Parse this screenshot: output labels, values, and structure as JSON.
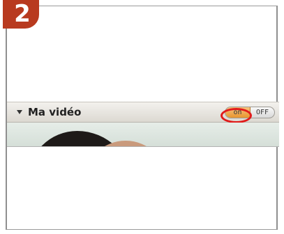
{
  "step": {
    "number": "2"
  },
  "panel": {
    "title": "Ma vidéo",
    "toggle": {
      "on_label": "on",
      "off_label": "OFF",
      "state": "on"
    }
  },
  "colors": {
    "badge": "#b83a1f",
    "toggle_on": "#e8962f",
    "highlight": "#e11b1b"
  }
}
